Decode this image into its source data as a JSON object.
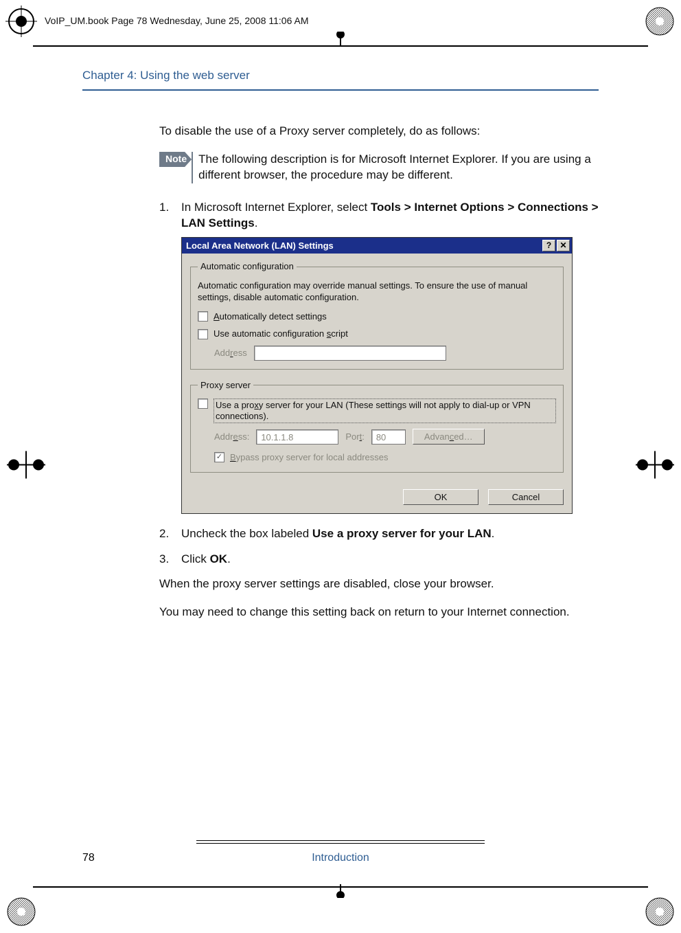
{
  "print": {
    "bookmark": "VoIP_UM.book  Page 78  Wednesday, June 25, 2008  11:06 AM"
  },
  "header": {
    "chapter": "Chapter 4:  Using the web server"
  },
  "content": {
    "lead": "To disable the use of a Proxy server completely, do as follows:",
    "note_tag": "Note",
    "note_text": "The following description is for Microsoft Internet Explorer. If you are using a different browser, the procedure may be different.",
    "step1_pre": "In Microsoft Internet Explorer, select ",
    "step1_bold": "Tools > Internet Options > Connections > LAN Settings",
    "step1_post": ".",
    "step2_pre": "Uncheck the box labeled ",
    "step2_bold": "Use a proxy server for your LAN",
    "step2_post": ".",
    "step3_pre": "Click ",
    "step3_bold": "OK",
    "step3_post": ".",
    "outro1": "When the proxy server settings are disabled, close your browser.",
    "outro2": "You may need to change this setting back on return to your Internet connection."
  },
  "dialog": {
    "title": "Local Area Network (LAN) Settings",
    "help_btn": "?",
    "close_btn": "✕",
    "auto": {
      "legend": "Automatic configuration",
      "desc": "Automatic configuration may override manual settings.  To ensure the use of manual settings, disable automatic configuration.",
      "ck1_pre": "A",
      "ck1_rest": "utomatically detect settings",
      "ck2": "Use automatic configuration ",
      "ck2_u": "s",
      "ck2_rest": "cript",
      "addr_u": "r",
      "addr_pre": "Add",
      "addr_post": "ess"
    },
    "proxy": {
      "legend": "Proxy server",
      "opt_pre": "Use a pro",
      "opt_u": "x",
      "opt_mid": "y server for your LAN (These settings will not apply to dial-up or VPN connections).",
      "addr_label_pre": "Addr",
      "addr_label_u": "e",
      "addr_label_post": "ss:",
      "addr_value": "10.1.1.8",
      "port_label_pre": "Por",
      "port_label_u": "t",
      "port_label_post": ":",
      "port_value": "80",
      "advanced_pre": "Advan",
      "advanced_u": "c",
      "advanced_post": "ed…",
      "bypass_pre": "B",
      "bypass_rest": "ypass proxy server for local addresses"
    },
    "buttons": {
      "ok": "OK",
      "cancel": "Cancel"
    }
  },
  "footer": {
    "page_num": "78",
    "section": "Introduction"
  }
}
